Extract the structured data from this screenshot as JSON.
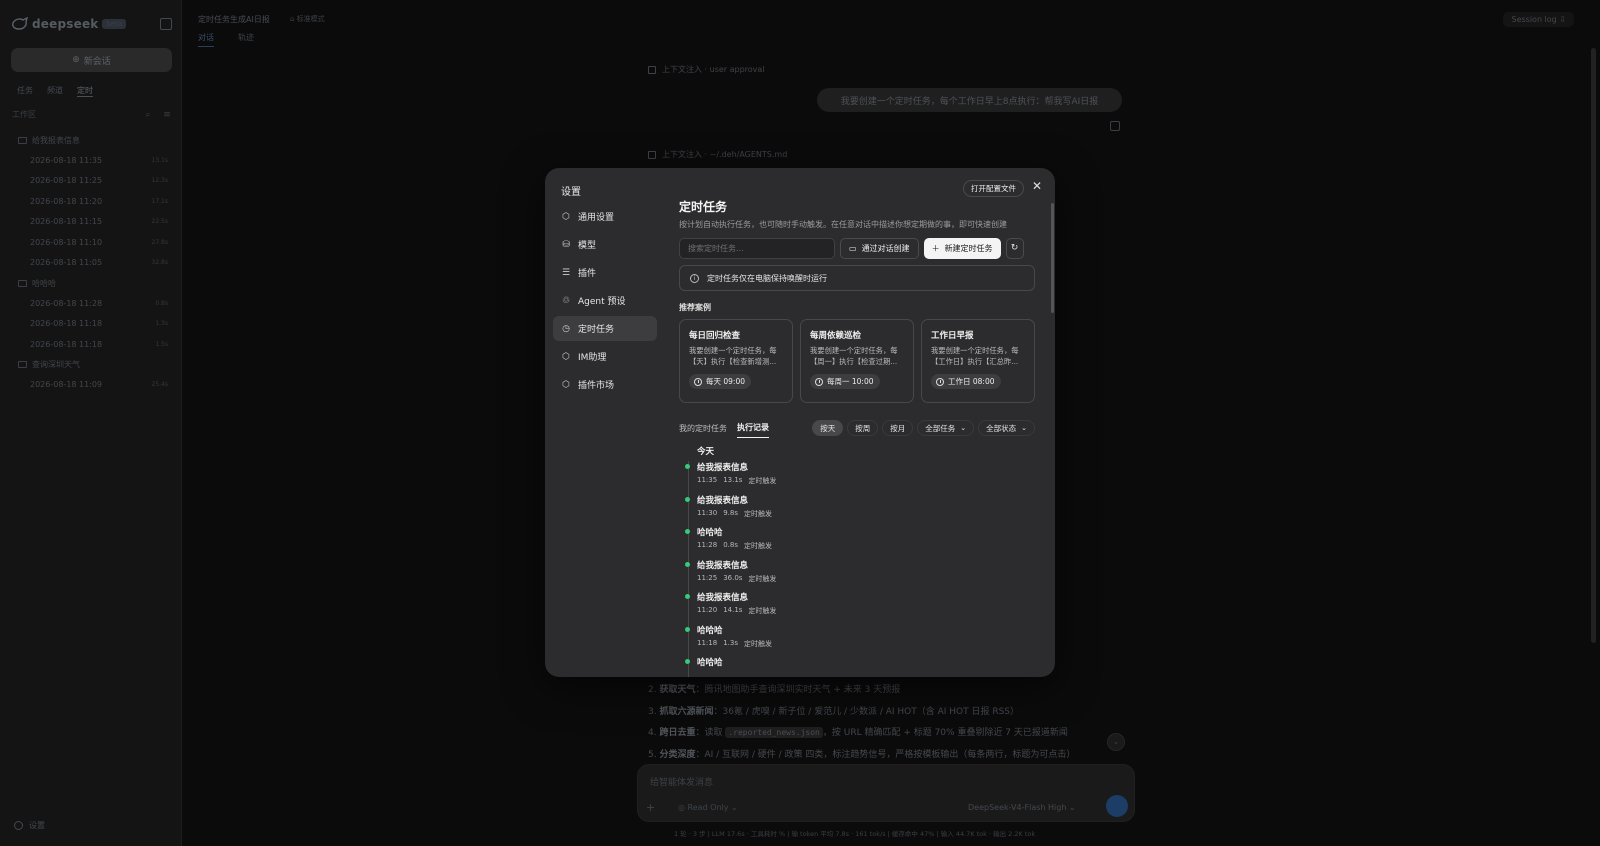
{
  "app": {
    "logo_text": "deepseek",
    "logo_badge": "beta",
    "new_chat_label": "新会话",
    "side_tabs": [
      "任务",
      "频道",
      "定时"
    ],
    "active_side_tab": 2,
    "workspace_label": "工作区",
    "tree": [
      {
        "folder": "给我报表信息",
        "items": [
          {
            "time": "2026-08-18 11:35",
            "size": "13.1s"
          },
          {
            "time": "2026-08-18 11:25",
            "size": "12.3s"
          },
          {
            "time": "2026-08-18 11:20",
            "size": "17.1s"
          },
          {
            "time": "2026-08-18 11:15",
            "size": "22.5s"
          },
          {
            "time": "2026-08-18 11:10",
            "size": "27.8s"
          },
          {
            "time": "2026-08-18 11:05",
            "size": "32.8s"
          }
        ]
      },
      {
        "folder": "哈哈哈",
        "items": [
          {
            "time": "2026-08-18 11:28",
            "size": "0.8s"
          },
          {
            "time": "2026-08-18 11:18",
            "size": "1.3s"
          },
          {
            "time": "2026-08-18 11:18",
            "size": "1.5s"
          }
        ]
      },
      {
        "folder": "查询深圳天气",
        "items": [
          {
            "time": "2026-08-18 11:09",
            "size": "25.4s"
          }
        ]
      }
    ],
    "settings_link": "设置"
  },
  "topbar": {
    "title": "定时任务生成AI日报",
    "mode": "标准模式",
    "tabs": [
      "对话",
      "轨迹"
    ],
    "session_log": "Session log"
  },
  "chat": {
    "context1": "上下文注入 · user approval",
    "user_message": "我要创建一个定时任务，每个工作日早上8点执行：帮我写AI日报",
    "context2": "上下文注入 · ~/.deh/AGENTS.md",
    "list": [
      {
        "num": "2.",
        "bold": "获取天气",
        "text": "：腾讯地图助手查询深圳实时天气 + 未来 3 天预报"
      },
      {
        "num": "3.",
        "bold": "抓取六源新闻",
        "text": "：36氪 / 虎嗅 / 新子位 / 爱范儿 / 少数派 / AI HOT（含 AI HOT 日报 RSS）"
      },
      {
        "num": "4.",
        "bold": "跨日去重",
        "text": "：读取 ",
        "code": ".reported_news.json",
        "text2": "，按 URL 精确匹配 + 标题 70% 重叠剔除近 7 天已报道新闻"
      },
      {
        "num": "5.",
        "bold": "分类深度",
        "text": "：AI / 互联网 / 硬件 / 政策 四类，标注趋势信号，严格按模板输出（每条两行，标题为可点击）"
      }
    ],
    "composer_placeholder": "给智能体发消息",
    "read_only": "Read Only",
    "model": "DeepSeek-V4-Flash",
    "effort": "High",
    "status_line": "1 轮 · 3 步   |   LLM 17.6s · 工具耗时 %   |   输 token 平均 7.8s · 161 tok/s   |   缓存命中 47%   |   输入 44.7K tok · 输出 2.2K tok"
  },
  "settings_modal": {
    "title": "设置",
    "open_config": "打开配置文件",
    "nav": [
      {
        "label": "通用设置",
        "icon": "hexagon-icon"
      },
      {
        "label": "模型",
        "icon": "database-icon"
      },
      {
        "label": "插件",
        "icon": "sliders-icon"
      },
      {
        "label": "Agent 预设",
        "icon": "agent-icon"
      },
      {
        "label": "定时任务",
        "icon": "clock-icon"
      },
      {
        "label": "IM助理",
        "icon": "hexagon-icon"
      },
      {
        "label": "插件市场",
        "icon": "hexagon-icon"
      }
    ],
    "active_nav": 4,
    "heading": "定时任务",
    "description": "按计划自动执行任务，也可随时手动触发。在任意对话中描述你想定期做的事，即可快速创建",
    "search_placeholder": "搜索定时任务...",
    "create_via_chat": "通过对话创建",
    "new_task": "新建定时任务",
    "notice": "定时任务仅在电脑保持唤醒时运行",
    "recommended_label": "推荐案例",
    "cards": [
      {
        "title": "每日回归检查",
        "desc": "我要创建一个定时任务，每【天】执行【检查新增测...",
        "schedule": "每天 09:00"
      },
      {
        "title": "每周依赖巡检",
        "desc": "我要创建一个定时任务，每【周一】执行【检查过期...",
        "schedule": "每周一 10:00"
      },
      {
        "title": "工作日早报",
        "desc": "我要创建一个定时任务，每【工作日】执行【汇总昨...",
        "schedule": "工作日 08:00"
      }
    ],
    "subtabs": [
      "我的定时任务",
      "执行记录"
    ],
    "active_subtab": 1,
    "filters": {
      "by_day": "按天",
      "by_week": "按周",
      "by_month": "按月",
      "all_tasks": "全部任务",
      "all_status": "全部状态"
    },
    "day_label": "今天",
    "records": [
      {
        "name": "给我报表信息",
        "time": "11:35",
        "duration": "13.1s",
        "trigger": "定时触发"
      },
      {
        "name": "给我报表信息",
        "time": "11:30",
        "duration": "9.8s",
        "trigger": "定时触发"
      },
      {
        "name": "哈哈哈",
        "time": "11:28",
        "duration": "0.8s",
        "trigger": "定时触发"
      },
      {
        "name": "给我报表信息",
        "time": "11:25",
        "duration": "36.0s",
        "trigger": "定时触发"
      },
      {
        "name": "给我报表信息",
        "time": "11:20",
        "duration": "14.1s",
        "trigger": "定时触发"
      },
      {
        "name": "哈哈哈",
        "time": "11:18",
        "duration": "1.3s",
        "trigger": "定时触发"
      },
      {
        "name": "哈哈哈",
        "time": "",
        "duration": "",
        "trigger": ""
      }
    ],
    "status_color": "#37c97a"
  }
}
